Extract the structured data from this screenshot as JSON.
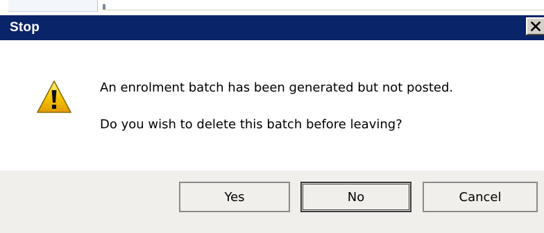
{
  "dialog": {
    "title": "Stop",
    "message_line1": "An enrolment batch has been generated but not posted.",
    "message_line2": "Do you wish to delete this batch before leaving?",
    "icon": "warning-icon"
  },
  "buttons": {
    "yes_label": "Yes",
    "no_label": "No",
    "cancel_label": "Cancel",
    "default": "No"
  },
  "colors": {
    "titlebar": "#0a246a",
    "footer": "#f0efeb",
    "warning_fill": "#f5c400"
  }
}
